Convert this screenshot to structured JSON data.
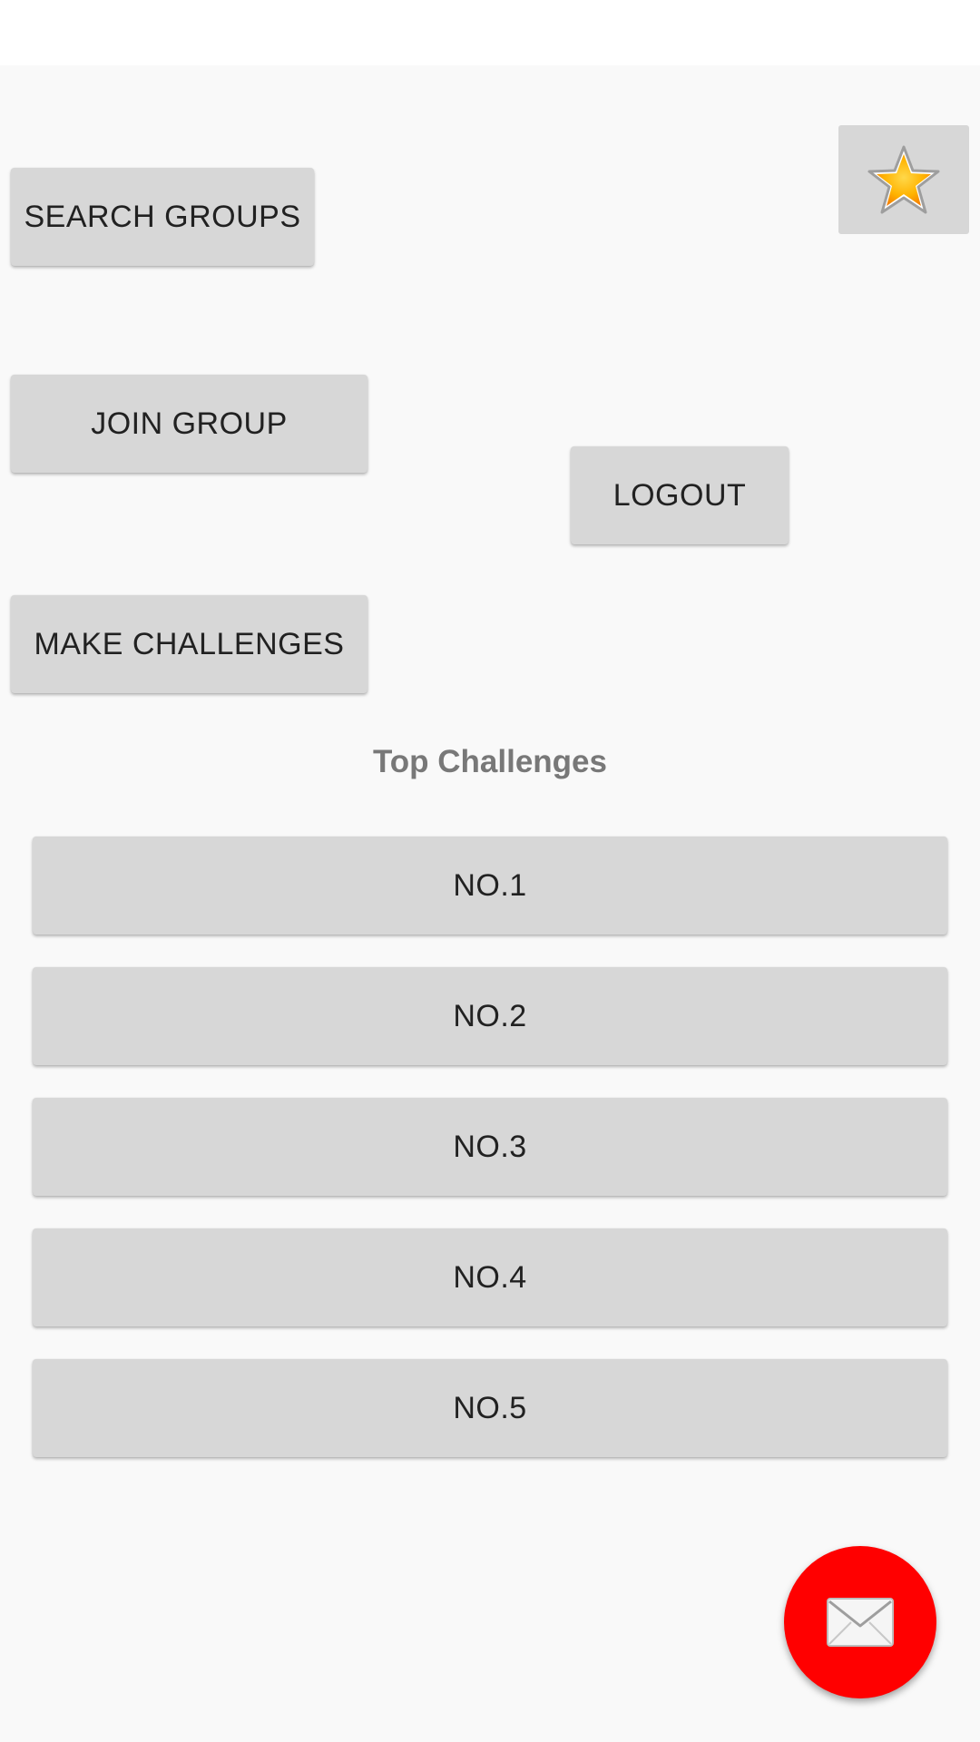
{
  "buttons": {
    "search_groups": "SEARCH GROUPS",
    "join_group": "JOIN GROUP",
    "logout": "LOGOUT",
    "make_challenges": "MAKE CHALLENGES"
  },
  "top_challenges": {
    "title": "Top Challenges",
    "items": [
      "NO.1",
      "NO.2",
      "NO.3",
      "NO.4",
      "NO.5"
    ]
  },
  "icons": {
    "favorite": "star-icon",
    "fab": "mail-icon"
  },
  "colors": {
    "fab": "#ff0000",
    "button": "#d7d7d7",
    "title": "#787878"
  }
}
